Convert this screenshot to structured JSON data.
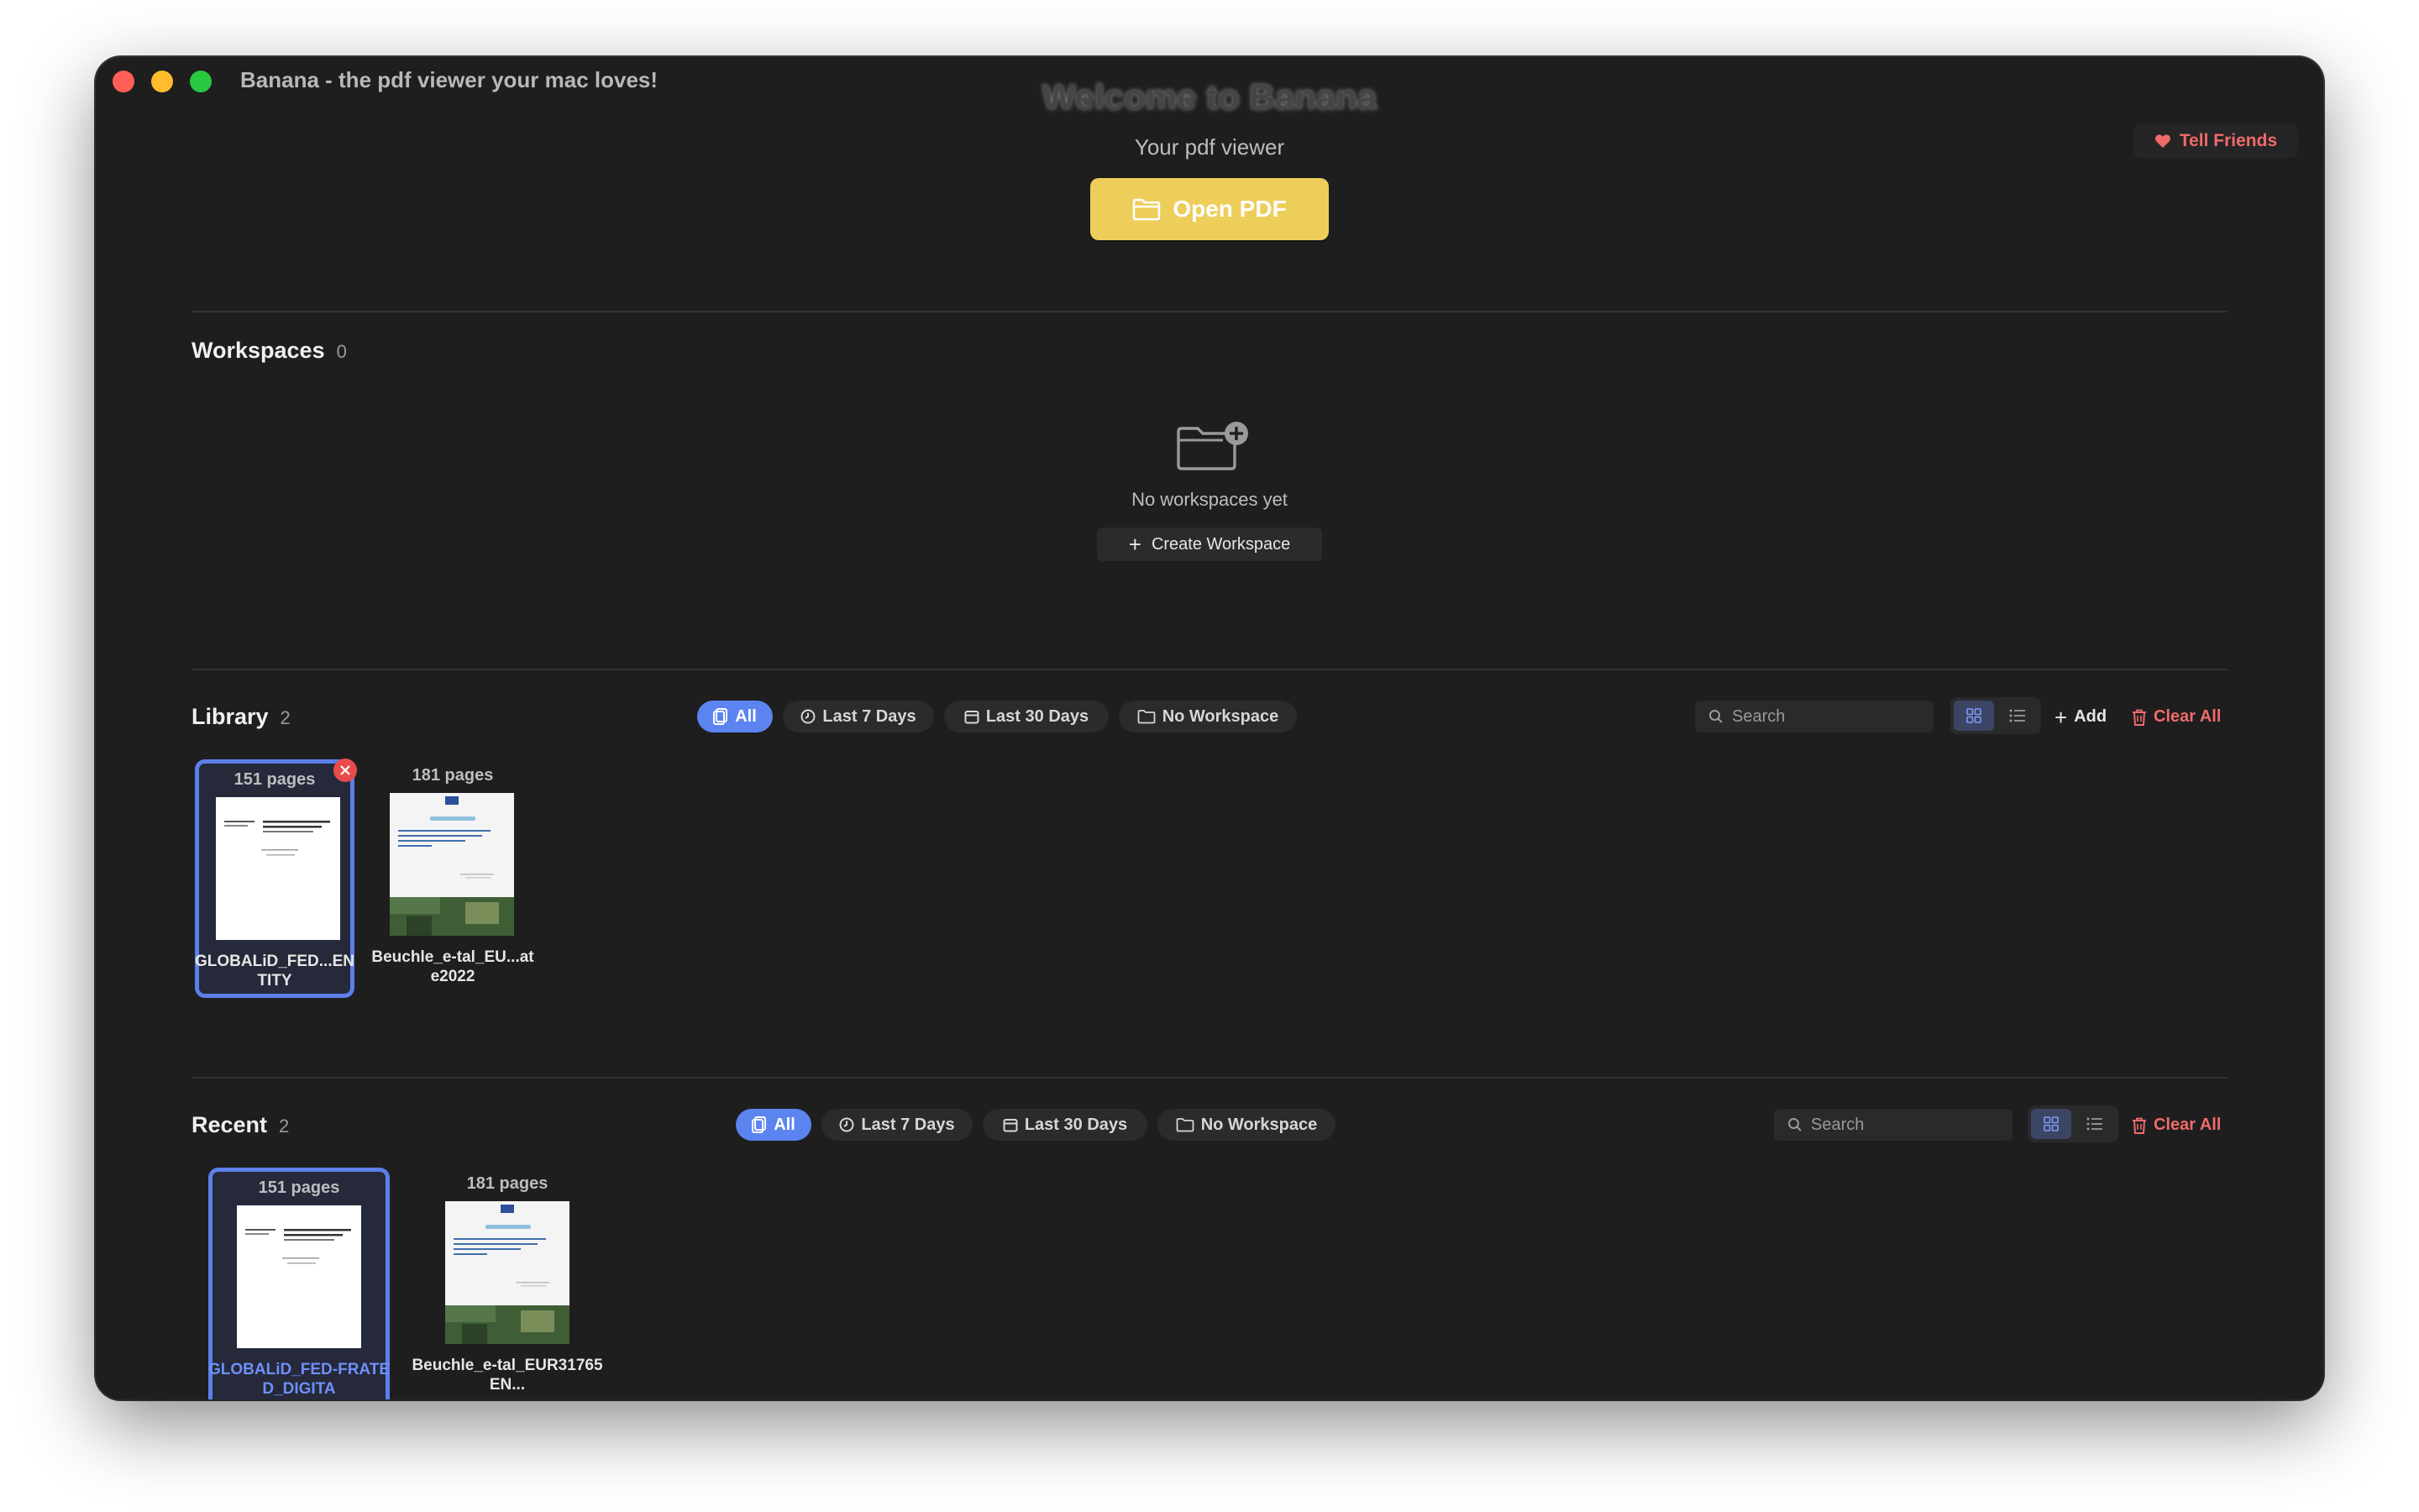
{
  "window": {
    "title": "Banana - the pdf viewer your mac loves!"
  },
  "header": {
    "welcome": "Welcome to Banana",
    "subtitle": "Your pdf viewer",
    "open_pdf": "Open PDF",
    "tell_friends": "Tell Friends"
  },
  "workspaces": {
    "title": "Workspaces",
    "count": "0",
    "empty_text": "No workspaces yet",
    "create_label": "Create Workspace"
  },
  "library": {
    "title": "Library",
    "count": "2",
    "filters": [
      {
        "label": "All",
        "icon": "documents-icon"
      },
      {
        "label": "Last 7 Days",
        "icon": "clock-icon"
      },
      {
        "label": "Last 30 Days",
        "icon": "calendar-icon"
      },
      {
        "label": "No Workspace",
        "icon": "folder-icon"
      }
    ],
    "search_placeholder": "Search",
    "add_label": "Add",
    "clear_all": "Clear All",
    "items": [
      {
        "pages": "151 pages",
        "name": "GLOBALiD_FED...ENTITY"
      },
      {
        "pages": "181 pages",
        "name": "Beuchle_e-tal_EU...ate2022"
      }
    ]
  },
  "recent": {
    "title": "Recent",
    "count": "2",
    "filters": [
      {
        "label": "All",
        "icon": "documents-icon"
      },
      {
        "label": "Last 7 Days",
        "icon": "clock-icon"
      },
      {
        "label": "Last 30 Days",
        "icon": "calendar-icon"
      },
      {
        "label": "No Workspace",
        "icon": "folder-icon"
      }
    ],
    "search_placeholder": "Search",
    "clear_all": "Clear All",
    "items": [
      {
        "pages": "151 pages",
        "name": "GLOBALiD_FED-FRATED_DIGITA"
      },
      {
        "pages": "181 pages",
        "name": "Beuchle_e-tal_EUR31765EN..."
      }
    ]
  },
  "colors": {
    "accent_blue": "#5b84f0",
    "open_pdf_yellow": "#edce5a",
    "danger_red": "#f06a6a",
    "window_bg": "#1e1e1f"
  }
}
